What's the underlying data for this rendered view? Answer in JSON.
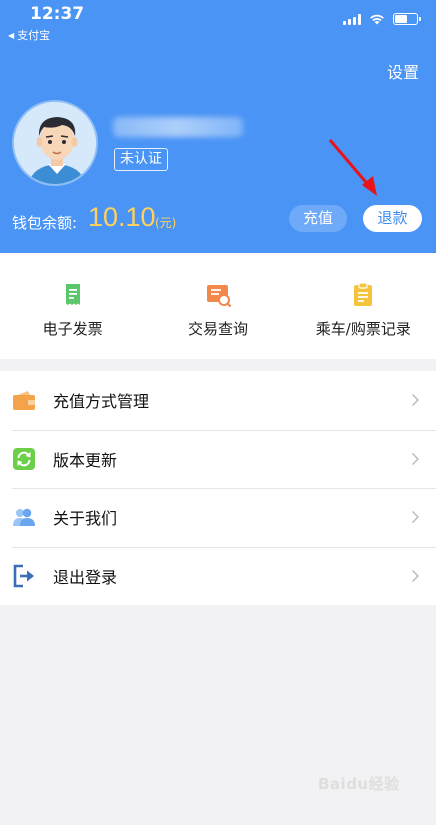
{
  "status_bar": {
    "time": "12:37",
    "back_app": "支付宝",
    "icons": [
      "signal-icon",
      "wifi-icon",
      "battery-icon"
    ]
  },
  "header": {
    "settings_label": "设置",
    "verify_badge": "未认证",
    "balance_label": "钱包余额:",
    "balance_value": "10.10",
    "balance_unit": "(元)",
    "recharge_label": "充值",
    "refund_label": "退款",
    "background_color": "#4a94f5",
    "balance_color": "#ffd15c",
    "annotation": "red-arrow pointing to refund button"
  },
  "quick_actions": [
    {
      "label": "电子发票",
      "icon": "invoice-icon",
      "color": "#5cc66a"
    },
    {
      "label": "交易查询",
      "icon": "transaction-search-icon",
      "color": "#f2884a"
    },
    {
      "label": "乘车/购票记录",
      "icon": "clipboard-icon",
      "color": "#f5c43c"
    }
  ],
  "menu": [
    {
      "label": "充值方式管理",
      "icon": "wallet-icon",
      "color": "#f5a34a"
    },
    {
      "label": "版本更新",
      "icon": "refresh-icon",
      "color": "#6ccf4a"
    },
    {
      "label": "关于我们",
      "icon": "people-icon",
      "color": "#6aa5f0"
    },
    {
      "label": "退出登录",
      "icon": "logout-icon",
      "color": "#3a6fb8"
    }
  ],
  "watermark": "Baidu经验"
}
